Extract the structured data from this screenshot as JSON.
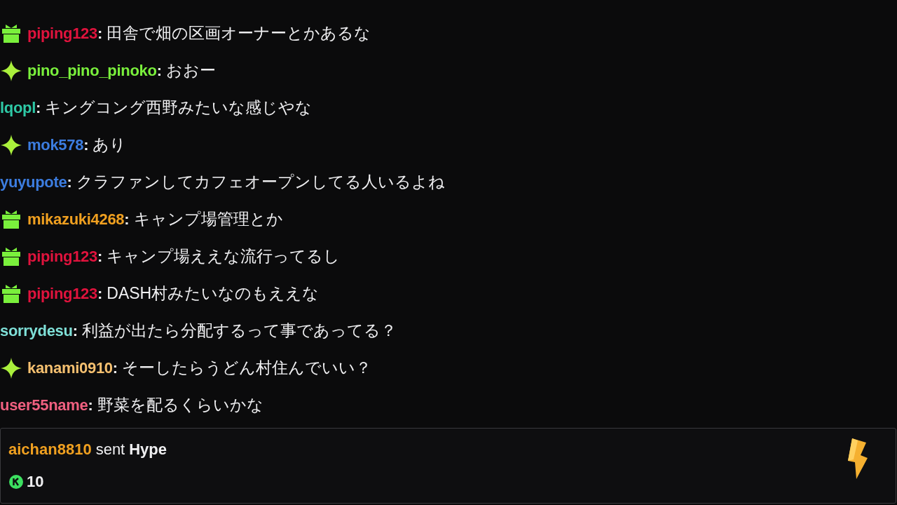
{
  "messages": [
    {
      "kind": "gift",
      "user": "piping123",
      "color": "#e0133d",
      "separator": ":",
      "text": "田舎で畑の区画オーナーとかあるな"
    },
    {
      "kind": "sparkle",
      "user": "pino_pino_pinoko",
      "color": "#7af03c",
      "separator": ":",
      "text": "おおー"
    },
    {
      "kind": "plain",
      "user": "lqopl",
      "color": "#2ec9a6",
      "separator": ":",
      "text": "キングコング西野みたいな感じやな"
    },
    {
      "kind": "sparkle",
      "user": "mok578",
      "color": "#3c7de0",
      "separator": ":",
      "text": "あり"
    },
    {
      "kind": "plain",
      "user": "yuyupote",
      "color": "#3c7de0",
      "separator": ":",
      "text": "クラファンしてカフェオープンしてる人いるよね"
    },
    {
      "kind": "gift",
      "user": "mikazuki4268",
      "color": "#f0a020",
      "separator": ":",
      "text": "キャンプ場管理とか"
    },
    {
      "kind": "gift",
      "user": "piping123",
      "color": "#e0133d",
      "separator": ":",
      "text": "キャンプ場ええな流行ってるし"
    },
    {
      "kind": "gift",
      "user": "piping123",
      "color": "#e0133d",
      "separator": ":",
      "text": "DASH村みたいなのもええな"
    },
    {
      "kind": "plain",
      "user": "sorrydesu",
      "color": "#7fe0d8",
      "separator": ":",
      "text": "利益が出たら分配するって事であってる？"
    },
    {
      "kind": "sparkle",
      "user": "kanami0910",
      "color": "#f5c070",
      "separator": ":",
      "text": "そーしたらうどん村住んでいい？"
    },
    {
      "kind": "plain",
      "user": "user55name",
      "color": "#f06080",
      "separator": ":",
      "text": "野菜を配るくらいかな"
    }
  ],
  "gift_card": {
    "user": "aichan8810",
    "verb": "sent",
    "item": "Hype",
    "amount": "10"
  }
}
